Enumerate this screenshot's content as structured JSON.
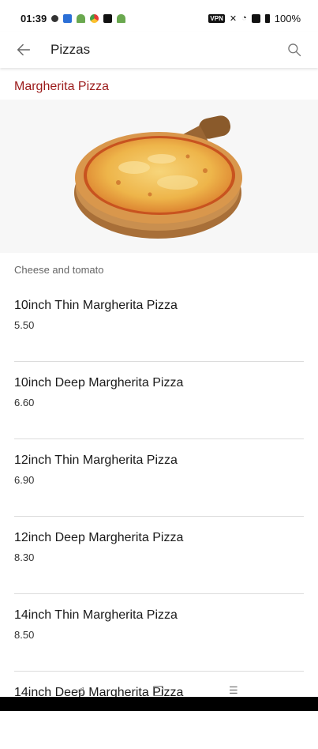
{
  "status_bar": {
    "time": "01:39",
    "battery": "100%"
  },
  "app_bar": {
    "title": "Pizzas",
    "back_icon": "arrow-left-icon",
    "search_icon": "search-icon"
  },
  "category": {
    "title": "Margherita Pizza",
    "description": "Cheese and tomato",
    "image": "pizza-image"
  },
  "items": [
    {
      "name": "10inch Thin Margherita Pizza",
      "price": "5.50"
    },
    {
      "name": "10inch Deep Margherita Pizza",
      "price": "6.60"
    },
    {
      "name": "12inch Thin Margherita Pizza",
      "price": "6.90"
    },
    {
      "name": "12inch Deep Margherita Pizza",
      "price": "8.30"
    },
    {
      "name": "14inch Thin Margherita Pizza",
      "price": "8.50"
    },
    {
      "name": "14inch Deep Margherita Pizza",
      "price": ""
    }
  ],
  "colors": {
    "accent": "#9b1b1b",
    "divider": "#dcdcdc"
  }
}
